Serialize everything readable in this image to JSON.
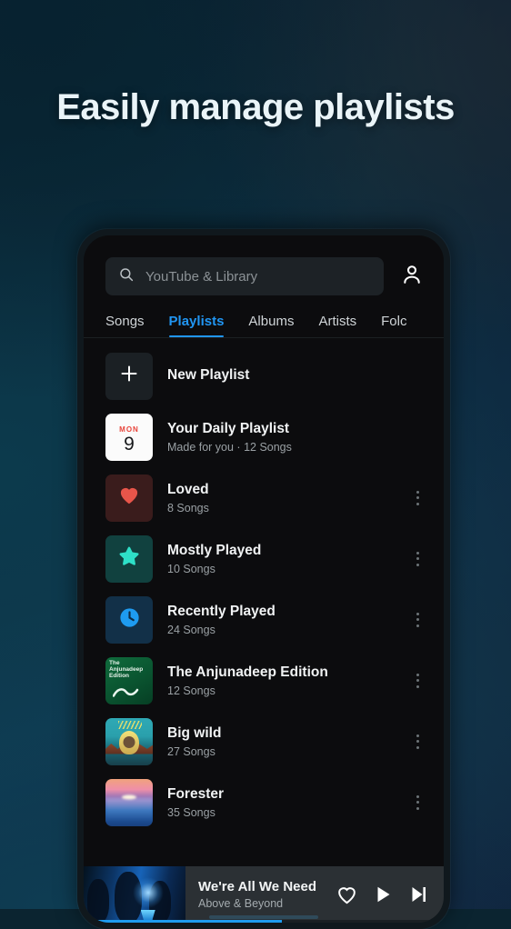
{
  "promo": {
    "headline": "Easily manage playlists"
  },
  "colors": {
    "accent_blue": "#2196f3",
    "progress_blue": "#1e9bf0",
    "loved_red": "#e8554a",
    "star_teal": "#2ee0c8",
    "clock_blue": "#1e9bf0",
    "calendar_red": "#e8443a",
    "anjunadeep_green": "#0a5430",
    "screen_bg": "#0c0c0e",
    "player_bg": "#2b3034"
  },
  "app": {
    "search": {
      "placeholder": "YouTube & Library",
      "icon": "search-icon",
      "value": ""
    },
    "account_icon": "account-avatar-icon",
    "tabs": [
      {
        "label": "Songs",
        "active": false
      },
      {
        "label": "Playlists",
        "active": true
      },
      {
        "label": "Albums",
        "active": false
      },
      {
        "label": "Artists",
        "active": false
      },
      {
        "label": "Folc",
        "active": false
      }
    ],
    "playlists": [
      {
        "title": "New Playlist",
        "subtitle": "",
        "art": "plus-icon",
        "has_menu": false
      },
      {
        "title": "Your Daily Playlist",
        "subtitle": "Made for you · 12 Songs",
        "art": "calendar-icon",
        "calendar_dow": "MON",
        "calendar_day": "9",
        "has_menu": false
      },
      {
        "title": "Loved",
        "subtitle": "8 Songs",
        "art": "heart-icon",
        "has_menu": true
      },
      {
        "title": "Mostly Played",
        "subtitle": "10 Songs",
        "art": "star-icon",
        "has_menu": true
      },
      {
        "title": "Recently Played",
        "subtitle": "24 Songs",
        "art": "clock-icon",
        "has_menu": true
      },
      {
        "title": "The Anjunadeep Edition",
        "subtitle": "12 Songs",
        "art": "album-artwork",
        "art_text": "The\nAnjunadeep\nEdition",
        "has_menu": true
      },
      {
        "title": "Big wild",
        "subtitle": "27 Songs",
        "art": "album-artwork",
        "has_menu": true
      },
      {
        "title": "Forester",
        "subtitle": "35 Songs",
        "art": "album-artwork",
        "has_menu": true
      }
    ],
    "now_playing": {
      "title": "We're All We Need",
      "artist": "Above & Beyond",
      "artwork": "now-playing-artwork",
      "favorite_icon": "heart-outline-icon",
      "play_icon": "play-icon",
      "next_icon": "skip-next-icon",
      "progress_percent": 55
    }
  }
}
